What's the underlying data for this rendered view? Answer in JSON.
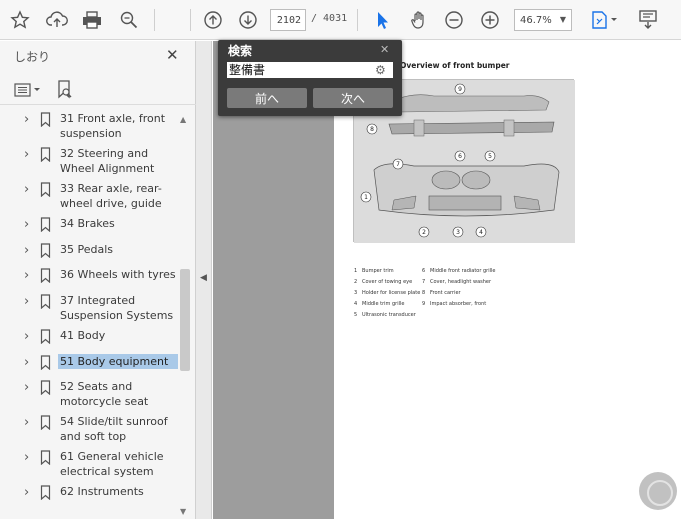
{
  "toolbar": {
    "page_current": "2102",
    "page_total": "/ 4031",
    "zoom": "46.7%",
    "icons": [
      "star-icon",
      "upload-icon",
      "printer-icon",
      "zoom-search-icon",
      "arrow-up-circle-icon",
      "arrow-down-circle-icon",
      "cursor-select-icon",
      "hand-pan-icon",
      "zoom-out-icon",
      "zoom-in-icon",
      "page-fit-icon",
      "comment-icon"
    ]
  },
  "sidebar": {
    "title": "しおり",
    "items": [
      {
        "label": "31 Front axle, front suspension",
        "selected": false
      },
      {
        "label": "32 Steering and Wheel Alignment",
        "selected": false
      },
      {
        "label": "33 Rear axle, rear-wheel drive, guide",
        "selected": false
      },
      {
        "label": "34 Brakes",
        "selected": false
      },
      {
        "label": "35 Pedals",
        "selected": false
      },
      {
        "label": "36 Wheels with tyres",
        "selected": false
      },
      {
        "label": "37 Integrated Suspension Systems",
        "selected": false
      },
      {
        "label": "41 Body",
        "selected": false
      },
      {
        "label": "51 Body equipment",
        "selected": true
      },
      {
        "label": "52 Seats and motorcycle seat",
        "selected": false
      },
      {
        "label": "54 Slide/tilt sunroof and soft top",
        "selected": false
      },
      {
        "label": "61 General vehicle electrical system",
        "selected": false
      },
      {
        "label": "62 Instruments",
        "selected": false
      }
    ]
  },
  "search": {
    "title": "検索",
    "query": "整備書",
    "prev_label": "前へ",
    "next_label": "次へ"
  },
  "document": {
    "title": "Overview of front bumper",
    "legend_left": [
      {
        "n": "1",
        "text": "Bumper trim"
      },
      {
        "n": "2",
        "text": "Cover of towing eye"
      },
      {
        "n": "3",
        "text": "Holder for license plate"
      },
      {
        "n": "4",
        "text": "Middle trim grille"
      },
      {
        "n": "5",
        "text": "Ultrasonic transducer"
      }
    ],
    "legend_right": [
      {
        "n": "6",
        "text": "Middle front radiator grille"
      },
      {
        "n": "7",
        "text": "Cover, headlight washer"
      },
      {
        "n": "8",
        "text": "Front carrier"
      },
      {
        "n": "9",
        "text": "Impact absorber, front"
      }
    ]
  },
  "colors": {
    "selection": "#a9c9e8",
    "accent": "#1a73e8",
    "popup_bg": "#3b3b3b"
  }
}
